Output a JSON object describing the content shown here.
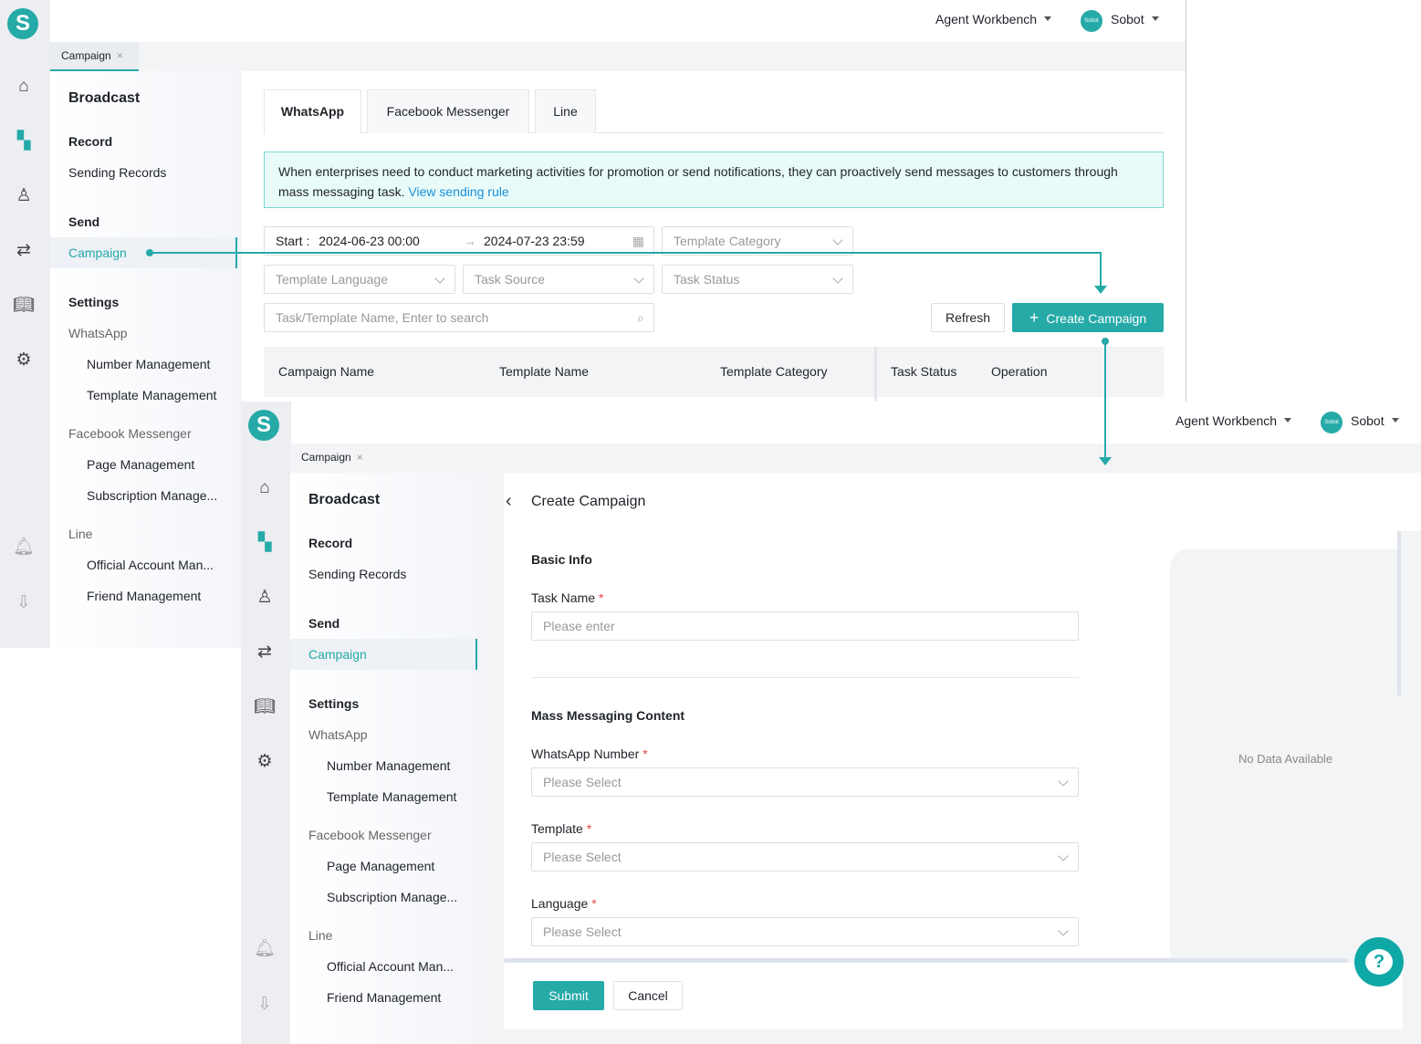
{
  "header": {
    "workbench": "Agent Workbench",
    "user": "Sobot",
    "avatar_text": "Sobot",
    "logo": "S"
  },
  "page_tab": {
    "label": "Campaign",
    "close": "×"
  },
  "nav": {
    "title": "Broadcast",
    "record": "Record",
    "sending_records": "Sending Records",
    "send": "Send",
    "campaign": "Campaign",
    "settings": "Settings",
    "whatsapp": "WhatsApp",
    "number_mgmt": "Number Management",
    "template_mgmt": "Template Management",
    "facebook": "Facebook Messenger",
    "page_mgmt": "Page Management",
    "subscription_mgmt": "Subscription Manage...",
    "line": "Line",
    "official_account": "Official Account Man...",
    "friend_mgmt": "Friend Management"
  },
  "rail_icons": [
    "home-icon",
    "apps-icon",
    "agent-icon",
    "route-icon",
    "book-icon",
    "settings-icon",
    "bell-icon",
    "download-icon"
  ],
  "list_page": {
    "tabs": [
      "WhatsApp",
      "Facebook Messenger",
      "Line"
    ],
    "notice": "When enterprises need to conduct marketing activities for promotion or send notifications, they can proactively send messages to customers through mass messaging task.",
    "notice_link": "View sending rule",
    "date_start_label": "Start :",
    "date_start": "2024-06-23 00:00",
    "date_sep": "→",
    "date_end": "2024-07-23 23:59",
    "filters": {
      "template_category": "Template Category",
      "template_language": "Template Language",
      "task_source": "Task Source",
      "task_status": "Task Status"
    },
    "search_placeholder": "Task/Template Name, Enter to search",
    "refresh": "Refresh",
    "create": "Create Campaign",
    "columns": [
      "Campaign Name",
      "Template Name",
      "Template Category",
      "Task Status",
      "Operation"
    ]
  },
  "create_page": {
    "title": "Create Campaign",
    "basic_info": "Basic Info",
    "task_name_label": "Task Name",
    "task_name_placeholder": "Please enter",
    "mass_content": "Mass Messaging Content",
    "whatsapp_number_label": "WhatsApp Number",
    "template_label": "Template",
    "language_label": "Language",
    "select_placeholder": "Please Select",
    "required_mark": "*",
    "preview_empty": "No Data Available",
    "submit": "Submit",
    "cancel": "Cancel",
    "help": "?"
  },
  "colors": {
    "accent": "#25aaa8",
    "notice_bg": "#e8fbf9",
    "required": "#e54545"
  }
}
